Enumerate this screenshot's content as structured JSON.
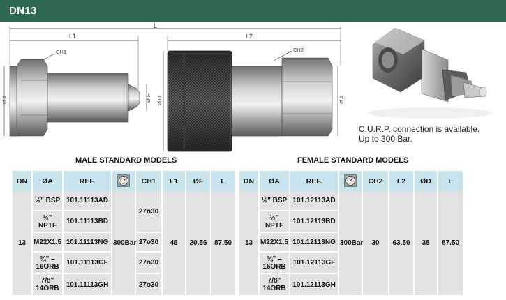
{
  "header": {
    "title": "DN13",
    "color": "#2f6a50"
  },
  "drawing": {
    "dim_L": "L",
    "dim_L1": "L1",
    "dim_L2": "L2",
    "label_CH1": "CH1",
    "label_CH2": "CH2",
    "label_OA_left": "Ø A",
    "label_OF": "Ø F",
    "label_OD": "Ø D",
    "label_OA_right": "Ø A"
  },
  "note": {
    "line1": "C.U.R.P. connection is available.",
    "line2": "Up to 300 Bar."
  },
  "male": {
    "title": "MALE STANDARD MODELS",
    "headers": {
      "dn": "DN",
      "oa": "ØA",
      "ref": "REF.",
      "ch1": "CH1",
      "l1": "L1",
      "of": "ØF",
      "l": "L"
    },
    "dn": "13",
    "pressure": "300Bar",
    "l1": "46",
    "of": "20.56",
    "l": "87.50",
    "rows": [
      {
        "oa": "½\" BSP",
        "ref": "101.11113AD"
      },
      {
        "oa": "½\" NPTF",
        "ref": "101.11113BD"
      },
      {
        "oa": "M22X1.5",
        "ref": "101.11113NG"
      },
      {
        "oa": "¾\" – 16ORB",
        "ref": "101.11113GF"
      },
      {
        "oa": "7/8\" 14ORB",
        "ref": "101.11113GH"
      }
    ],
    "ch1": [
      "27o30",
      "27o30",
      "27o30",
      "27o30"
    ]
  },
  "female": {
    "title": "FEMALE STANDARD MODELS",
    "headers": {
      "dn": "DN",
      "oa": "ØA",
      "ref": "REF.",
      "ch2": "CH2",
      "l2": "L2",
      "od": "ØD",
      "l": "L"
    },
    "dn": "13",
    "pressure": "300Bar",
    "ch2": "30",
    "l2": "63.50",
    "od": "38",
    "l": "87.50",
    "rows": [
      {
        "oa": "½\" BSP",
        "ref": "101.12113AD"
      },
      {
        "oa": "½\" NPTF",
        "ref": "101.12113BD"
      },
      {
        "oa": "M22X1.5",
        "ref": "101.12113NG"
      },
      {
        "oa": "¾\" – 16ORB",
        "ref": "101.12113GF"
      },
      {
        "oa": "7/8\" 14ORB",
        "ref": "101.12113GH"
      }
    ]
  },
  "pressure_icon": "pressure-gauge-icon"
}
